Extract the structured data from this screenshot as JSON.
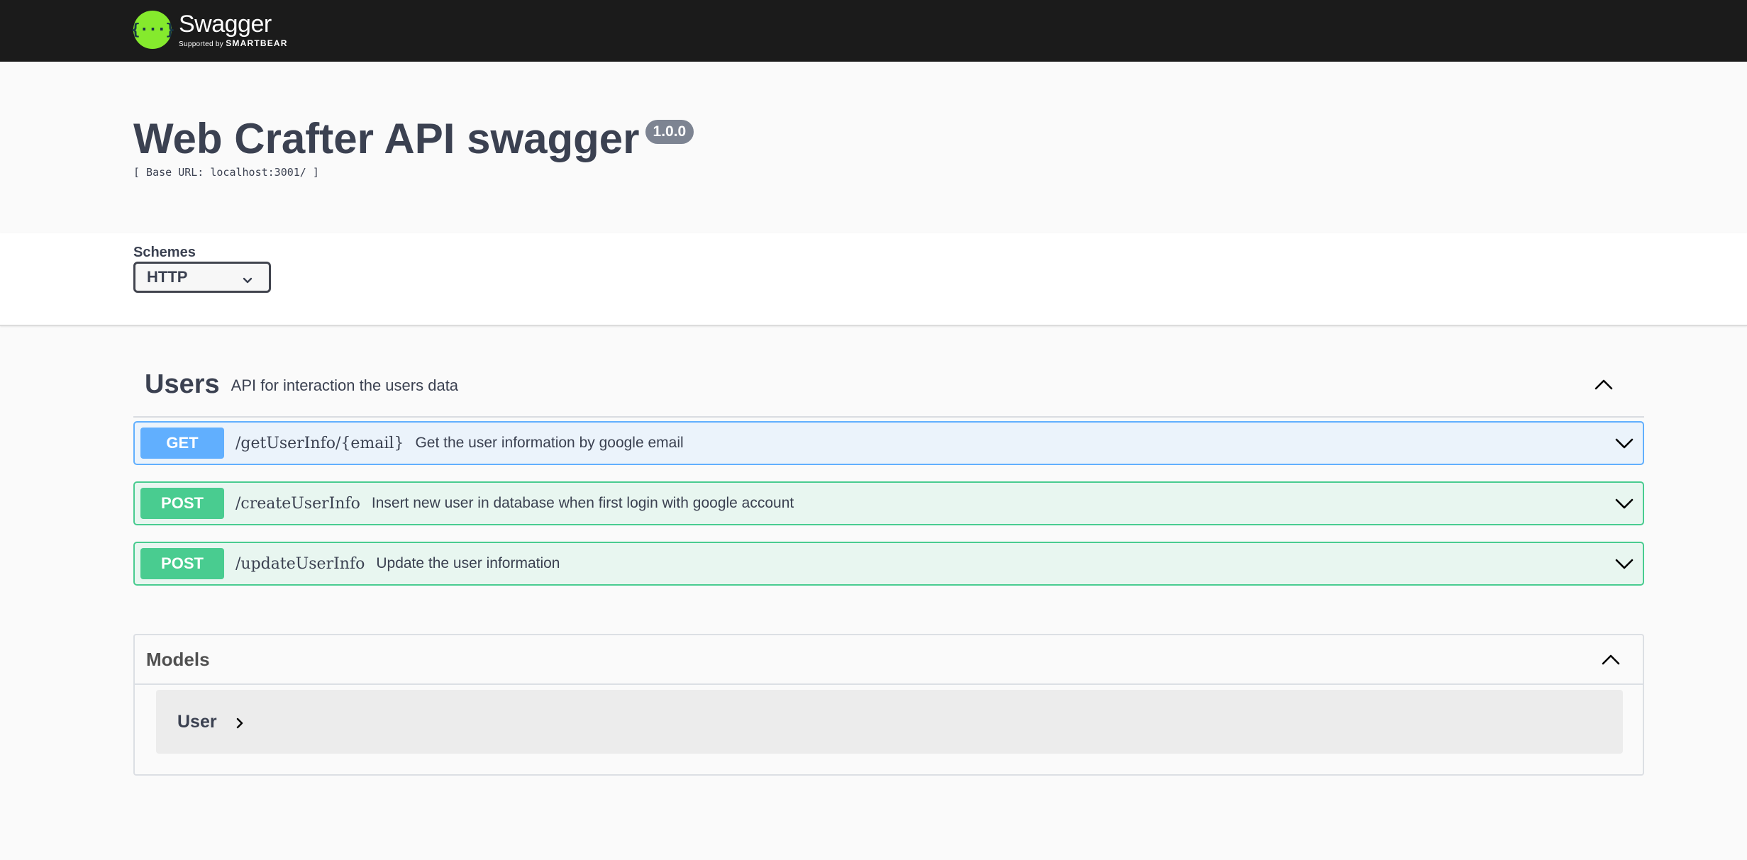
{
  "topbar": {
    "logo_glyph": "{···}",
    "brand_name": "Swagger",
    "brand_supported": "Supported by",
    "brand_company": "SMARTBEAR"
  },
  "info": {
    "title": "Web Crafter API swagger",
    "version": "1.0.0",
    "base_url": "[ Base URL: localhost:3001/ ]"
  },
  "schemes": {
    "label": "Schemes",
    "selected": "HTTP"
  },
  "tag": {
    "name": "Users",
    "description": "API for interaction the users data"
  },
  "operations": [
    {
      "method": "GET",
      "path": "/getUserInfo/{email}",
      "summary": "Get the user information by google email"
    },
    {
      "method": "POST",
      "path": "/createUserInfo",
      "summary": "Insert new user in database when first login with google account"
    },
    {
      "method": "POST",
      "path": "/updateUserInfo",
      "summary": "Update the user information"
    }
  ],
  "models": {
    "title": "Models",
    "items": [
      {
        "name": "User"
      }
    ]
  },
  "colors": {
    "topbar": "#1b1b1b",
    "logo": "#85ea2d",
    "get": "#61affe",
    "post": "#49cc90",
    "text": "#3b4151"
  },
  "icons": {
    "chevron_down": "chevron-down-icon",
    "chevron_up": "chevron-up-icon",
    "chevron_right": "chevron-right-icon"
  }
}
